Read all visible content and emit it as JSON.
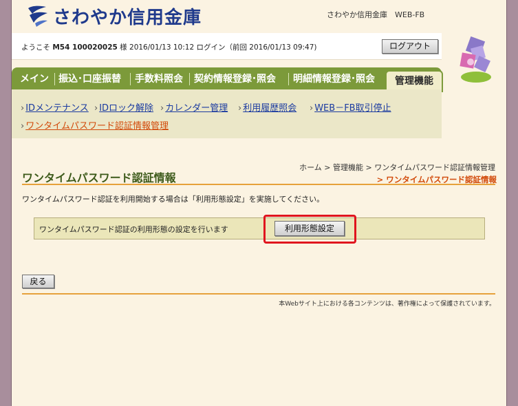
{
  "header": {
    "logo_text": "さわやか信用金庫",
    "bank_service": "さわやか信用金庫　WEB-FB",
    "brand_color": "#1f3a8c"
  },
  "welcome": {
    "prefix": "ようこそ",
    "user_id": "M54 100020025",
    "suffix": "様 2016/01/13 10:12 ログイン（前回 2016/01/13 09:47)",
    "logout_label": "ログアウト"
  },
  "nav": {
    "tabs": [
      {
        "label": "メイン"
      },
      {
        "label": "振込･口座振替"
      },
      {
        "label": "手数料照会"
      },
      {
        "label": "契約情報登録･照会"
      },
      {
        "label": "明細情報登録･照会"
      }
    ],
    "active_tab": "管理機能",
    "accent_color": "#7c9a3a"
  },
  "submenu": {
    "items": [
      {
        "label": "IDメンテナンス"
      },
      {
        "label": "IDロック解除"
      },
      {
        "label": "カレンダー管理"
      },
      {
        "label": "利用履歴照会"
      },
      {
        "label": "WEB－FB取引停止"
      },
      {
        "label": "ワンタイムパスワード認証情報管理"
      }
    ],
    "arrow": "›"
  },
  "main": {
    "title": "ワンタイムパスワード認証情報",
    "breadcrumb": "ホーム > 管理機能 > ワンタイムパスワード認証情報管理",
    "breadcrumb_current": "> ワンタイムパスワード認証情報",
    "instruction": "ワンタイムパスワード認証を利用開始する場合は「利用形態設定」を実施してください。",
    "setting_label": "ワンタイムパスワード認証の利用形態の設定を行います",
    "setting_button": "利用形態設定",
    "back_button": "戻る",
    "copyright": "本Webサイト上における各コンテンツは、著作権によって保護されています。"
  }
}
